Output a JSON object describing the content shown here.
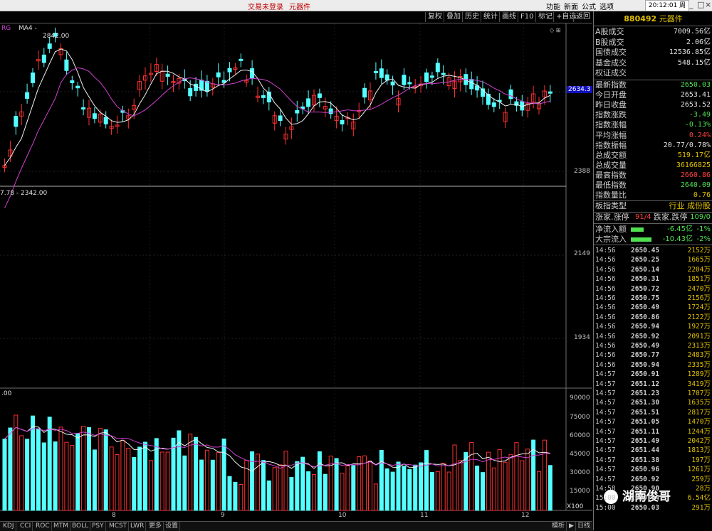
{
  "titlebar": {
    "status": "交易未登录",
    "sector": "元器件",
    "menu": [
      "功能",
      "新面",
      "公式",
      "选项"
    ],
    "clock": "20:12:01",
    "weekday": "周二"
  },
  "toolbar": {
    "buttons": [
      "复权",
      "叠加",
      "历史",
      "统计",
      "画线",
      "F10",
      "标记",
      "+自选",
      "返回"
    ]
  },
  "chart": {
    "ma_label": "MA4 -",
    "high_marker": "2842.00",
    "low_marker": "7.78 - 2342.00",
    "price_tag": "2634.3",
    "price_ticks": [
      "2388",
      "2149",
      "1934"
    ],
    "vol_label": ".00",
    "vol_ticks": [
      "90000",
      "75000",
      "60000",
      "45000",
      "30000",
      "15000"
    ],
    "vol_unit": "X100",
    "date_labels": [
      "8",
      "9",
      "10",
      "11",
      "12"
    ],
    "colors": {
      "up": "#ff3030",
      "down": "#54ffff",
      "ma1": "#f0f0f0",
      "ma2": "#d040d0"
    }
  },
  "chart_data": {
    "type": "candlestick",
    "price_axis_ticks": [
      2388,
      2149,
      1934
    ],
    "current_value": 2634.3,
    "volume_axis_ticks": [
      90000,
      75000,
      60000,
      45000,
      30000,
      15000
    ],
    "x_labels": [
      "8",
      "9",
      "10",
      "11",
      "12"
    ]
  },
  "panel": {
    "header": {
      "code": "880492",
      "name": "元器件"
    },
    "stats": [
      {
        "label": "A股成交",
        "value": "7009.56亿",
        "tone": "wht"
      },
      {
        "label": "B股成交",
        "value": "2.06亿",
        "tone": "wht"
      },
      {
        "label": "国债成交",
        "value": "12536.85亿",
        "tone": "wht"
      },
      {
        "label": "基金成交",
        "value": "548.15亿",
        "tone": "wht"
      },
      {
        "label": "权证成交",
        "value": "",
        "tone": "wht"
      }
    ],
    "indices": [
      {
        "label": "最新指数",
        "value": "2650.03",
        "tone": "neg"
      },
      {
        "label": "今日开盘",
        "value": "2653.41",
        "tone": "wht"
      },
      {
        "label": "昨日收盘",
        "value": "2653.52",
        "tone": "wht"
      },
      {
        "label": "指数涨跌",
        "value": "-3.49",
        "tone": "neg"
      },
      {
        "label": "指数涨幅",
        "value": "-0.13%",
        "tone": "neg"
      },
      {
        "label": "平均涨幅",
        "value": "0.24%",
        "tone": "pos"
      },
      {
        "label": "指数振幅",
        "value": "20.77/0.78%",
        "tone": "wht"
      },
      {
        "label": "总成交额",
        "value": "519.17亿",
        "tone": "yel"
      },
      {
        "label": "总成交量",
        "value": "36166825",
        "tone": "yel"
      },
      {
        "label": "最高指数",
        "value": "2660.86",
        "tone": "pos"
      },
      {
        "label": "最低指数",
        "value": "2640.09",
        "tone": "neg"
      },
      {
        "label": "指数量比",
        "value": "0.76",
        "tone": "yel"
      }
    ],
    "type_row": {
      "label": "板指类型",
      "value": "行业 成份股"
    },
    "updown": {
      "up_label": "涨家.涨停",
      "up_value": "91/4",
      "down_label": "跌家.跌停",
      "down_value": "109/0"
    },
    "flows": [
      {
        "label": "净流入额",
        "value": "-6.45亿",
        "pct": "-1%",
        "bar": 0.35
      },
      {
        "label": "大宗流入",
        "value": "-10.43亿",
        "pct": "-2%",
        "bar": 0.55
      }
    ],
    "ticks": [
      {
        "time": "14:56",
        "price": "2650.45",
        "vol": "2152万"
      },
      {
        "time": "14:56",
        "price": "2650.25",
        "vol": "1665万"
      },
      {
        "time": "14:56",
        "price": "2650.14",
        "vol": "2204万"
      },
      {
        "time": "14:56",
        "price": "2650.31",
        "vol": "1851万"
      },
      {
        "time": "14:56",
        "price": "2650.72",
        "vol": "2470万"
      },
      {
        "time": "14:56",
        "price": "2650.75",
        "vol": "2156万"
      },
      {
        "time": "14:56",
        "price": "2650.49",
        "vol": "1724万"
      },
      {
        "time": "14:56",
        "price": "2650.86",
        "vol": "2122万"
      },
      {
        "time": "14:56",
        "price": "2650.94",
        "vol": "1927万"
      },
      {
        "time": "14:56",
        "price": "2650.92",
        "vol": "2091万"
      },
      {
        "time": "14:56",
        "price": "2650.49",
        "vol": "2313万"
      },
      {
        "time": "14:56",
        "price": "2650.77",
        "vol": "2483万"
      },
      {
        "time": "14:56",
        "price": "2650.94",
        "vol": "2335万"
      },
      {
        "time": "14:57",
        "price": "2650.91",
        "vol": "1289万"
      },
      {
        "time": "14:57",
        "price": "2651.12",
        "vol": "3419万"
      },
      {
        "time": "14:57",
        "price": "2651.23",
        "vol": "1707万"
      },
      {
        "time": "14:57",
        "price": "2651.30",
        "vol": "1635万"
      },
      {
        "time": "14:57",
        "price": "2651.51",
        "vol": "2817万"
      },
      {
        "time": "14:57",
        "price": "2651.05",
        "vol": "1470万"
      },
      {
        "time": "14:57",
        "price": "2651.11",
        "vol": "1244万"
      },
      {
        "time": "14:57",
        "price": "2651.49",
        "vol": "2042万"
      },
      {
        "time": "14:57",
        "price": "2651.44",
        "vol": "1813万"
      },
      {
        "time": "14:57",
        "price": "2651.38",
        "vol": "197万"
      },
      {
        "time": "14:57",
        "price": "2650.96",
        "vol": "1261万"
      },
      {
        "time": "14:57",
        "price": "2650.92",
        "vol": "259万"
      },
      {
        "time": "14:58",
        "price": "2650.90",
        "vol": "28万"
      },
      {
        "time": "15:00",
        "price": "2650.04",
        "vol": "6.54亿"
      },
      {
        "time": "15:00",
        "price": "2650.03",
        "vol": "291万"
      }
    ],
    "watermark": "湖南俊哥"
  },
  "tabs": {
    "items": [
      "KDJ",
      "CCI",
      "ROC",
      "MTM",
      "BOLL",
      "PSY",
      "MCST",
      "LWR",
      "更多",
      "设置"
    ],
    "right": [
      "模析",
      "▶",
      "日线"
    ]
  }
}
